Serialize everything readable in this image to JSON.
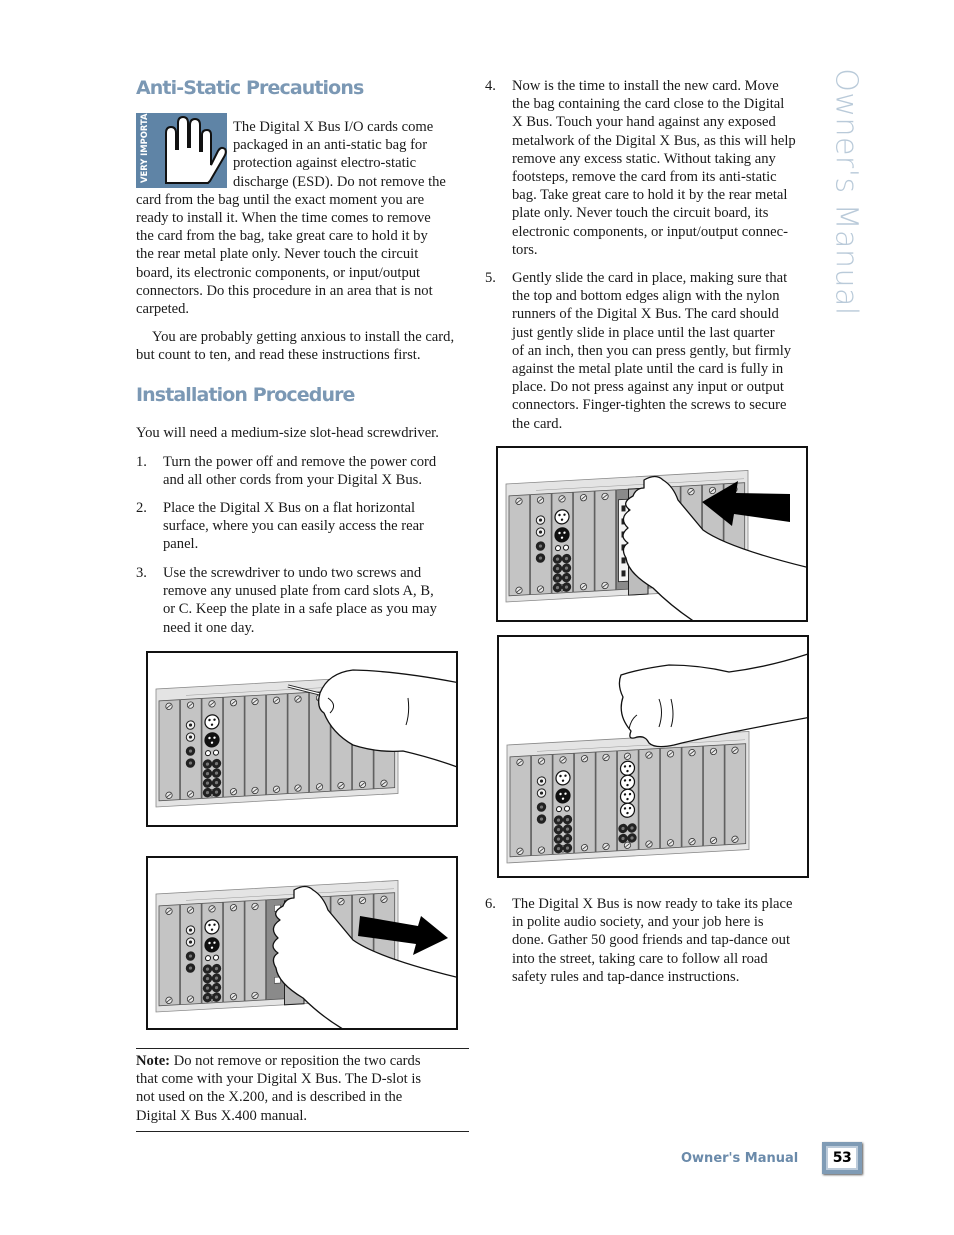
{
  "side_title": "Owner's Manual",
  "left": {
    "anti_static": {
      "heading": "Anti-Static Precautions",
      "icon": {
        "name": "stop-hand-icon",
        "label": "VERY IMPORTANT",
        "background": "#5f84a6"
      },
      "lines": [
        "The Digital X Bus I/O cards come",
        "packaged in an anti-static bag for",
        "protection against electro-static",
        "discharge (ESD). Do not remove the",
        "card from the bag until the exact moment you are",
        "ready to install it. When the time comes to remove",
        "the card from the bag, take great care to hold it by",
        "the rear metal plate only. Never touch the circuit",
        "board, its electronic components, or input/output",
        "connectors. Do this procedure in an area that is not",
        "carpeted."
      ],
      "para2_lines": [
        "You are probably getting anxious to install the card,",
        "but count to ten, and read these instructions first."
      ]
    },
    "installation": {
      "heading": "Installation Procedure",
      "intro": "You will need a medium-size slot-head screwdriver.",
      "steps": [
        {
          "num": "1.",
          "lines": [
            "Turn the power off and remove the power cord",
            "and all other cords from your Digital X Bus."
          ]
        },
        {
          "num": "2.",
          "lines": [
            "Place the Digital X Bus on a flat horizontal",
            "surface, where you can easily access the rear",
            "panel."
          ]
        },
        {
          "num": "3.",
          "lines": [
            "Use the screwdriver to undo two screws and",
            "remove any unused plate from card slots A, B,",
            "or C. Keep the plate in a safe place as you may",
            "need it one day."
          ]
        }
      ]
    },
    "note": {
      "label": "Note:",
      "lines": [
        " Do not remove or reposition the two cards",
        "that come with your Digital X Bus. The D-slot is",
        "not used on the X.200, and is described in the",
        "Digital X Bus X.400 manual."
      ]
    }
  },
  "right": {
    "steps": [
      {
        "num": "4.",
        "lines": [
          "Now is the time to install the new card. Move",
          "the bag containing the card close to the Digital",
          "X Bus. Touch your hand against any exposed",
          "metalwork of the Digital X Bus, as this will help",
          "remove any excess static. Without taking any",
          "footsteps, remove the card from its anti-static",
          "bag. Take great care to hold it by the rear metal",
          "plate only. Never touch the circuit board, its",
          "electronic components, or input/output connec-",
          "tors."
        ]
      },
      {
        "num": "5.",
        "lines": [
          "Gently slide the card in place, making sure that",
          "the top and bottom edges align with the nylon",
          "runners of the Digital X Bus. The card should",
          "just gently slide in place until the last quarter",
          "of an inch, then you can press gently, but firmly",
          "against the metal plate until the card is fully in",
          "place. Do not press against any input or output",
          "connectors. Finger-tighten the screws to secure",
          "the card."
        ]
      },
      {
        "num": "6.",
        "lines": [
          "The Digital X Bus is now ready to take its place",
          "in polite audio society, and your job here is",
          "done. Gather 50 good friends and tap-dance out",
          "into the street, taking care to follow all road",
          "safety rules and tap-dance instructions."
        ]
      }
    ]
  },
  "figures": [
    {
      "id": "unscrew-plate",
      "action": "screwdriver",
      "arrow": "none"
    },
    {
      "id": "remove-plate",
      "action": "remove",
      "arrow": "right"
    },
    {
      "id": "insert-card",
      "action": "insert",
      "arrow": "left"
    },
    {
      "id": "tighten-screws",
      "action": "tighten",
      "arrow": "none"
    }
  ],
  "footer": {
    "label": "Owner's Manual",
    "page_number": "53"
  },
  "colors": {
    "heading": "#7b98b4",
    "accent": "#5f84a6",
    "side_title": "#b9cad9",
    "panel": "#c8c8c8"
  }
}
